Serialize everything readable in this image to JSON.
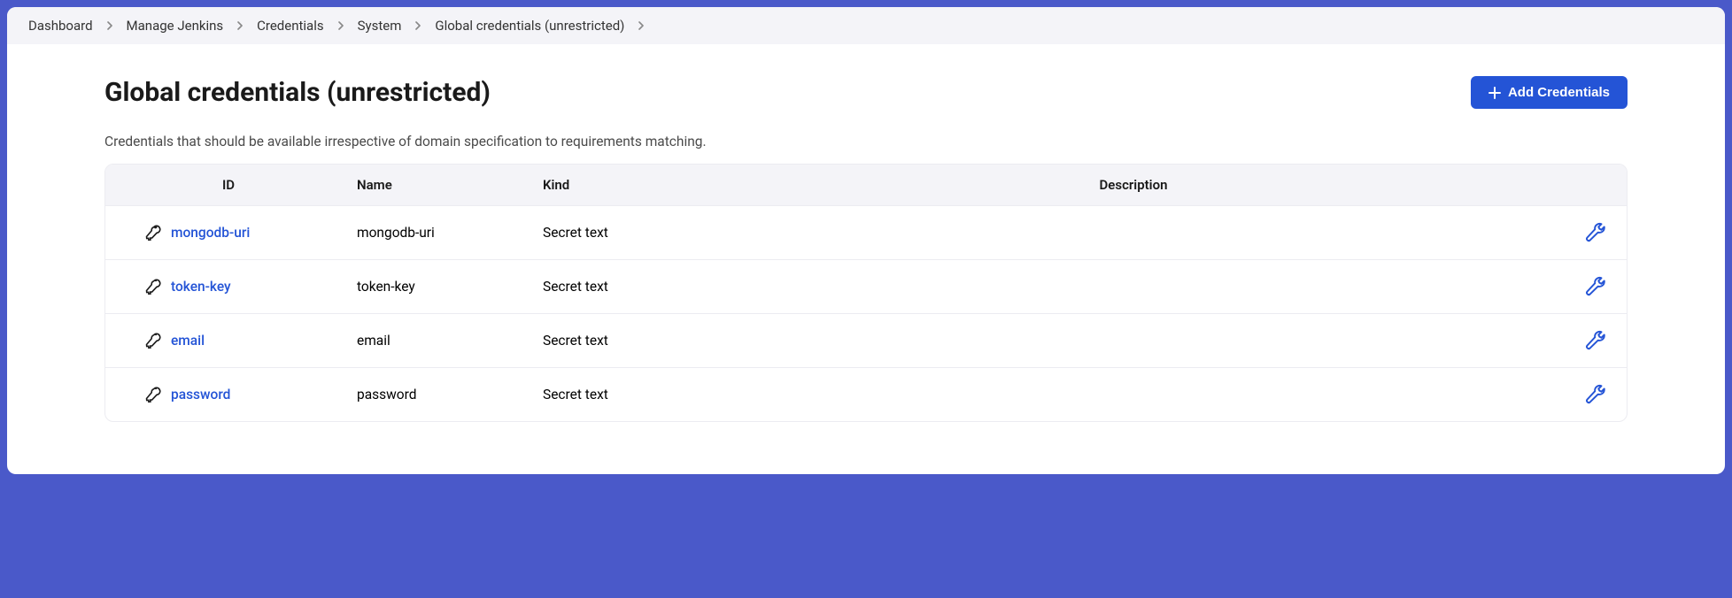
{
  "breadcrumbs": [
    {
      "label": "Dashboard"
    },
    {
      "label": "Manage Jenkins"
    },
    {
      "label": "Credentials"
    },
    {
      "label": "System"
    },
    {
      "label": "Global credentials (unrestricted)"
    }
  ],
  "header": {
    "title": "Global credentials (unrestricted)",
    "add_button": "Add Credentials"
  },
  "description": "Credentials that should be available irrespective of domain specification to requirements matching.",
  "table": {
    "headers": {
      "id": "ID",
      "name": "Name",
      "kind": "Kind",
      "description": "Description"
    },
    "rows": [
      {
        "id": "mongodb-uri",
        "name": "mongodb-uri",
        "kind": "Secret text",
        "description": ""
      },
      {
        "id": "token-key",
        "name": "token-key",
        "kind": "Secret text",
        "description": ""
      },
      {
        "id": "email",
        "name": "email",
        "kind": "Secret text",
        "description": ""
      },
      {
        "id": "password",
        "name": "password",
        "kind": "Secret text",
        "description": ""
      }
    ]
  }
}
